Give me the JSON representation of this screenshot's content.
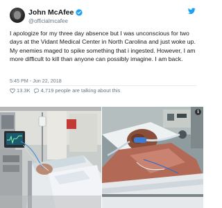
{
  "author": {
    "display_name": "John McAfee",
    "handle": "@officialmcafee",
    "avatar_icon": "user-avatar",
    "verified_icon": "verified-badge-icon",
    "verified_color": "#1da1f2"
  },
  "tweet": {
    "text": "I apologize for my three day absence but I was unconscious for two days at the Vidant Medical Center in North Carolina and just woke up. My enemies maged to spike something that i ingested. However, I am more difficult to kill than anyone can possibly imagine. I am back.",
    "time": "5:45 PM",
    "separator": "-",
    "date": "Jun 22, 2018"
  },
  "stats": {
    "likes": "13.3K",
    "talking": "4,719 people are talking about this",
    "like_icon": "heart-icon",
    "talking_icon": "comment-icon"
  },
  "brand": {
    "icon": "twitter-bird-icon",
    "color": "#1da1f2"
  },
  "media": {
    "info_label": "i",
    "photos": [
      "hospital-room-photo",
      "hospital-bed-photo"
    ]
  }
}
